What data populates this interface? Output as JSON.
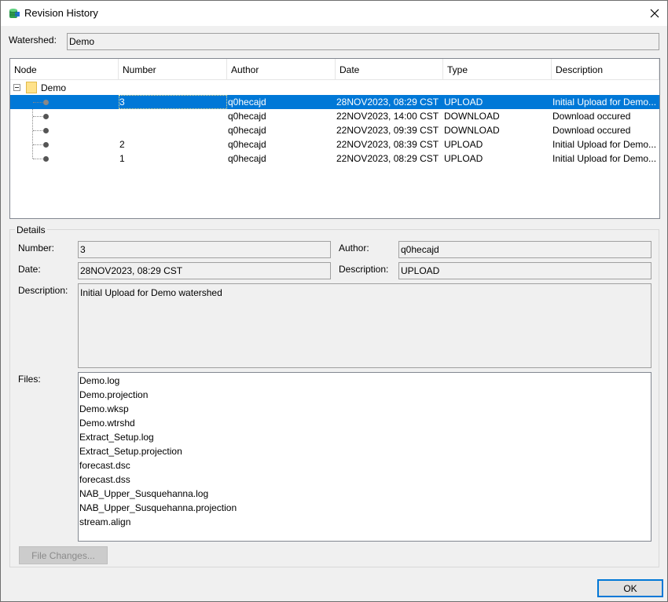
{
  "window": {
    "title": "Revision History",
    "icon": "database-network-icon",
    "close_icon": "close-icon"
  },
  "watershed": {
    "label": "Watershed:",
    "value": "Demo"
  },
  "table": {
    "columns": [
      "Node",
      "Number",
      "Author",
      "Date",
      "Type",
      "Description"
    ],
    "root": {
      "label": "Demo",
      "expander_icon": "minus-box-icon",
      "folder_icon": "folder-icon"
    },
    "rows": [
      {
        "number": "3",
        "author": "q0hecajd",
        "date": "28NOV2023, 08:29 CST",
        "type": "UPLOAD",
        "description": "Initial Upload for Demo...",
        "selected": true
      },
      {
        "number": "",
        "author": "q0hecajd",
        "date": "22NOV2023, 14:00 CST",
        "type": "DOWNLOAD",
        "description": "Download occured",
        "selected": false
      },
      {
        "number": "",
        "author": "q0hecajd",
        "date": "22NOV2023, 09:39 CST",
        "type": "DOWNLOAD",
        "description": "Download occured",
        "selected": false
      },
      {
        "number": "2",
        "author": "q0hecajd",
        "date": "22NOV2023, 08:39 CST",
        "type": "UPLOAD",
        "description": "Initial Upload for Demo...",
        "selected": false
      },
      {
        "number": "1",
        "author": "q0hecajd",
        "date": "22NOV2023, 08:29 CST",
        "type": "UPLOAD",
        "description": "Initial Upload for Demo...",
        "selected": false
      }
    ]
  },
  "details": {
    "group_title": "Details",
    "number_label": "Number:",
    "number_value": "3",
    "author_label": "Author:",
    "author_value": "q0hecajd",
    "date_label": "Date:",
    "date_value": "28NOV2023, 08:29 CST",
    "type_desc_label": "Description:",
    "type_desc_value": "UPLOAD",
    "description_label": "Description:",
    "description_value": "Initial Upload for Demo watershed",
    "files_label": "Files:",
    "files": [
      "Demo.log",
      "Demo.projection",
      "Demo.wksp",
      "Demo.wtrshd",
      "Extract_Setup.log",
      "Extract_Setup.projection",
      "forecast.dsc",
      "forecast.dss",
      "NAB_Upper_Susquehanna.log",
      "NAB_Upper_Susquehanna.projection",
      "stream.align"
    ],
    "file_changes_button": "File Changes..."
  },
  "footer": {
    "ok_button": "OK"
  },
  "colors": {
    "selection": "#0078d7",
    "window_bg": "#f0f0f0",
    "folder": "#ffe28a"
  }
}
